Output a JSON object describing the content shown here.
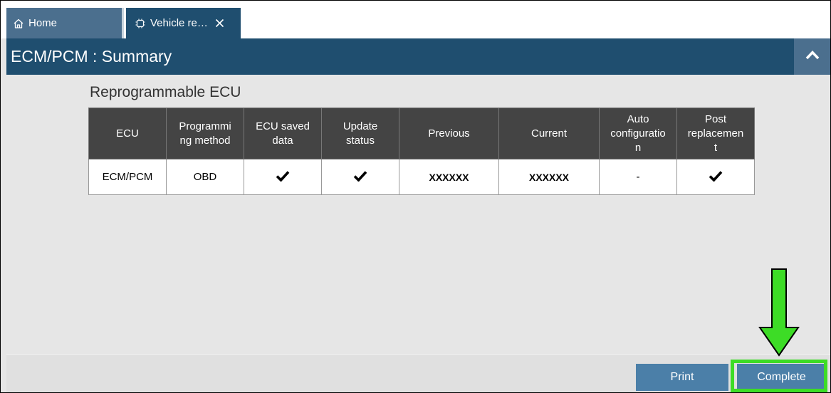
{
  "tabs": [
    {
      "label": "Home",
      "icon": "home-icon"
    },
    {
      "label": "Vehicle re…",
      "icon": "chip-icon"
    }
  ],
  "header": {
    "title": "ECM/PCM : Summary"
  },
  "section": {
    "title": "Reprogrammable ECU"
  },
  "table": {
    "columns": [
      {
        "label": "ECU"
      },
      {
        "label": "Programmi\nng method"
      },
      {
        "label": "ECU saved\ndata"
      },
      {
        "label": "Update\nstatus"
      },
      {
        "label": "Previous"
      },
      {
        "label": "Current"
      },
      {
        "label": "Auto\nconfiguratio\nn"
      },
      {
        "label": "Post\nreplacemen\nt"
      }
    ],
    "rows": [
      {
        "ecu": "ECM/PCM",
        "programming_method": "OBD",
        "ecu_saved_data": "check",
        "update_status": "check",
        "previous": "XXXXXX",
        "current": "XXXXXX",
        "auto_configuration": "-",
        "post_replacement": "check"
      }
    ]
  },
  "footer": {
    "print_label": "Print",
    "complete_label": "Complete"
  },
  "colors": {
    "header_bg": "#1f4e6f",
    "tab_inactive": "#4b6f8e",
    "button": "#4b7fa8",
    "table_header": "#444444",
    "highlight": "#3ddc26"
  }
}
